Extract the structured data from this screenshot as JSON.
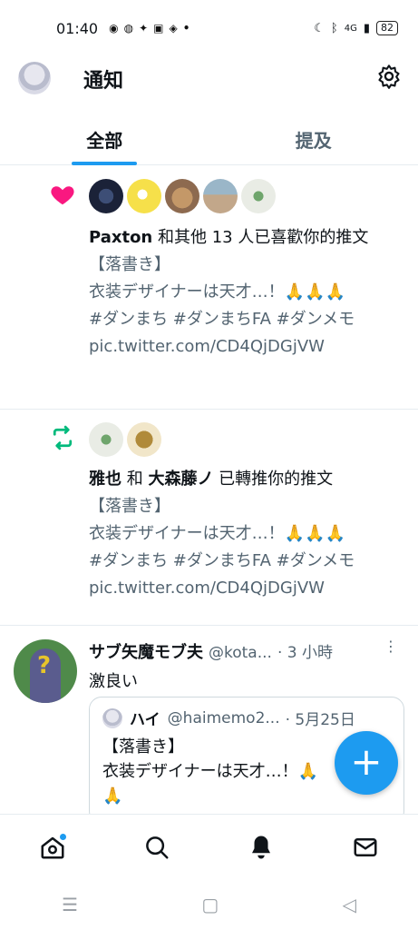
{
  "status_bar": {
    "time": "01:40",
    "battery": "82",
    "network": "4G"
  },
  "header": {
    "title": "通知"
  },
  "tabs": [
    {
      "label": "全部"
    },
    {
      "label": "提及"
    }
  ],
  "notifications": [
    {
      "type": "like",
      "actor": "Paxton",
      "action": " 和其他 13 人已喜歡你的推文",
      "lines": [
        "【落書き】",
        "衣装デザイナーは天才…！🙏🙏🙏",
        "#ダンまち #ダンまちFA #ダンメモ",
        "pic.twitter.com/CD4QjDGjVW"
      ]
    },
    {
      "type": "retweet",
      "actor1": "雅也",
      "conj": " 和 ",
      "actor2": "大森藤ノ",
      "action": " 已轉推你的推文",
      "lines": [
        "【落書き】",
        "衣装デザイナーは天才…！🙏🙏🙏",
        "#ダンまち #ダンまちFA #ダンメモ",
        "pic.twitter.com/CD4QjDGjVW"
      ]
    }
  ],
  "tweet": {
    "name": "サブ矢魔モブ夫",
    "handle": "@kota...",
    "time": "· 3 小時",
    "body": "激良い",
    "quote": {
      "name": "ハイ",
      "handle": "@haimemo2...",
      "date": "· 5月25日",
      "line1": "【落書き】",
      "line2": "衣装デザイナーは天才…！🙏",
      "line3": "🙏"
    }
  },
  "colors": {
    "accent": "#1d9bf0",
    "like": "#f91880",
    "retweet": "#00ba7c",
    "gray_text": "#536471"
  }
}
